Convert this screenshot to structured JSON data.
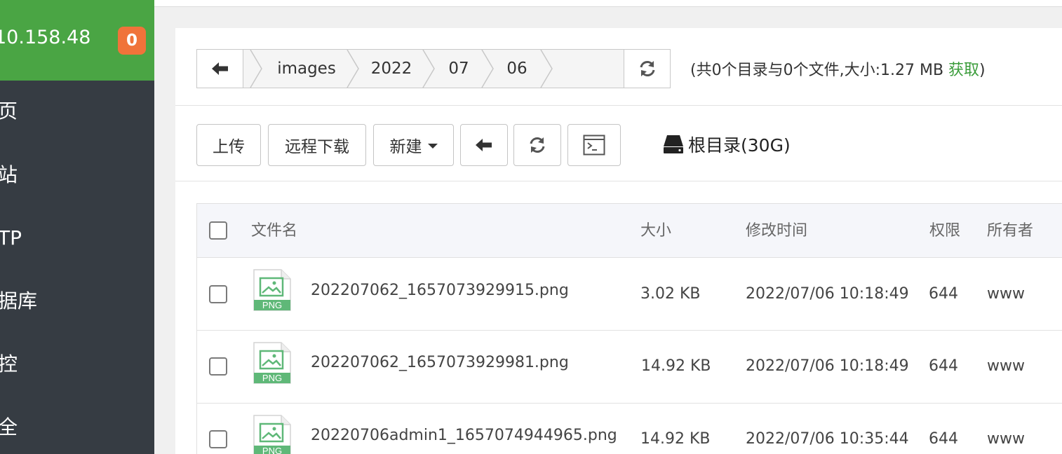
{
  "sidebar": {
    "server_ip": "10.158.48",
    "badge_count": "0",
    "menu": [
      "页",
      "站",
      "TP",
      "据库",
      "控",
      "全"
    ]
  },
  "path": {
    "crumbs": [
      "images",
      "2022",
      "07",
      "06"
    ]
  },
  "summary": {
    "text": "(共0个目录与0个文件,大小:1.27 MB ",
    "fetch_label": "获取",
    "close": ")"
  },
  "toolbar": {
    "upload": "上传",
    "remote_download": "远程下载",
    "new": "新建",
    "disk": "根目录(30G)"
  },
  "table": {
    "headers": {
      "name": "文件名",
      "size": "大小",
      "mtime": "修改时间",
      "perm": "权限",
      "owner": "所有者"
    },
    "icon_label": "PNG",
    "rows": [
      {
        "name": "202207062_1657073929915.png",
        "size": "3.02 KB",
        "mtime": "2022/07/06 10:18:49",
        "perm": "644",
        "owner": "www"
      },
      {
        "name": "202207062_1657073929981.png",
        "size": "14.92 KB",
        "mtime": "2022/07/06 10:18:49",
        "perm": "644",
        "owner": "www"
      },
      {
        "name": "20220706admin1_1657074944965.png",
        "size": "14.92 KB",
        "mtime": "2022/07/06 10:35:44",
        "perm": "644",
        "owner": "www"
      }
    ]
  },
  "colors": {
    "sidebar_bg": "#363c43",
    "sidebar_header": "#4aa544",
    "badge": "#f0733a",
    "fetch_link": "#3a9c3a"
  }
}
